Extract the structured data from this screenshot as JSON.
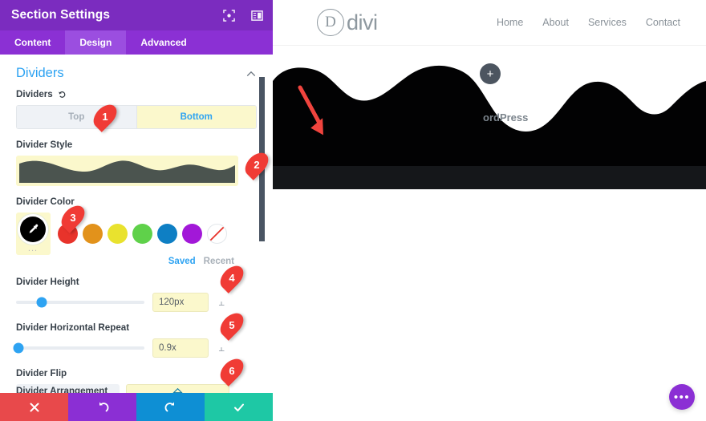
{
  "panel": {
    "title": "Section Settings",
    "header_icons": [
      "target-frame-icon",
      "panel-layout-icon"
    ],
    "tabs": [
      {
        "label": "Content",
        "active": false
      },
      {
        "label": "Design",
        "active": true
      },
      {
        "label": "Advanced",
        "active": false
      }
    ],
    "section": {
      "title": "Dividers",
      "collapse_icon": "chevron-up-icon"
    },
    "fields": {
      "dividers": {
        "label": "Dividers",
        "reset_icon": "reset-icon",
        "options": [
          {
            "label": "Top",
            "active": false
          },
          {
            "label": "Bottom",
            "active": true
          }
        ]
      },
      "divider_style": {
        "label": "Divider Style",
        "preview_color": "#4b544f",
        "preview_bg": "#fbf8cc"
      },
      "divider_color": {
        "label": "Divider Color",
        "selected": "#000000",
        "selected_icon": "eyedropper-icon",
        "more_label": "...",
        "swatches": [
          "#e8332b",
          "#e2921b",
          "#e9e22e",
          "#5fd14a",
          "#0e7fc4",
          "#a218d8",
          "transparent"
        ],
        "saved_label": "Saved",
        "recent_label": "Recent"
      },
      "divider_height": {
        "label": "Divider Height",
        "value": "120px",
        "slider_percent": 20
      },
      "divider_horizontal_repeat": {
        "label": "Divider Horizontal Repeat",
        "value": "0.9x",
        "slider_percent": 2
      },
      "divider_flip": {
        "label": "Divider Flip",
        "options": [
          {
            "icon": "flip-horizontal-icon",
            "active": false
          },
          {
            "icon": "flip-vertical-icon",
            "active": true
          }
        ]
      },
      "divider_arrangement": {
        "label": "Divider Arrangement"
      }
    },
    "actions": [
      {
        "name": "discard",
        "icon": "close-icon",
        "color": "#e8494b"
      },
      {
        "name": "undo",
        "icon": "undo-icon",
        "color": "#8b2fd4"
      },
      {
        "name": "redo",
        "icon": "redo-icon",
        "color": "#0e8fd4"
      },
      {
        "name": "save",
        "icon": "check-icon",
        "color": "#1ec8a5"
      }
    ]
  },
  "preview": {
    "logo": {
      "mark": "D",
      "text": "divi"
    },
    "nav": [
      "Home",
      "About",
      "Services",
      "Contact"
    ],
    "hero_text": "ordPress",
    "add_section_label": "+",
    "fab_label": "•••",
    "divider_fill": "#020203",
    "band_fill": "#15171a"
  },
  "callouts": [
    {
      "number": "1",
      "target": "dividers-toggle"
    },
    {
      "number": "2",
      "target": "divider-style-preview"
    },
    {
      "number": "3",
      "target": "divider-color-selected"
    },
    {
      "number": "4",
      "target": "divider-height-value"
    },
    {
      "number": "5",
      "target": "divider-repeat-value"
    },
    {
      "number": "6",
      "target": "divider-flip-vertical"
    }
  ]
}
